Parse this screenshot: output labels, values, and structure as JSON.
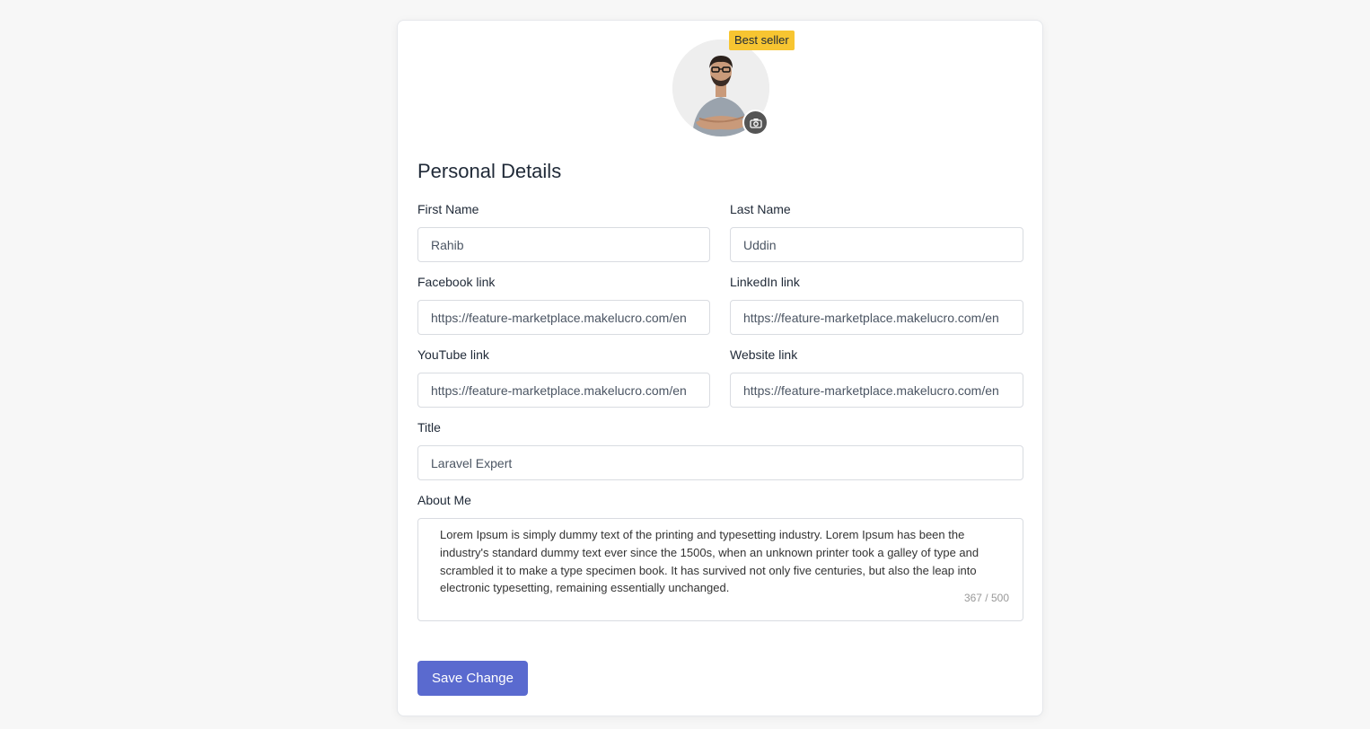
{
  "profile": {
    "badge": "Best seller",
    "avatar_icon": "camera-icon"
  },
  "section_title": "Personal Details",
  "fields": {
    "first_name": {
      "label": "First Name",
      "value": "Rahib"
    },
    "last_name": {
      "label": "Last Name",
      "value": "Uddin"
    },
    "facebook": {
      "label": "Facebook link",
      "value": "https://feature-marketplace.makelucro.com/en"
    },
    "linkedin": {
      "label": "LinkedIn link",
      "value": "https://feature-marketplace.makelucro.com/en"
    },
    "youtube": {
      "label": "YouTube link",
      "value": "https://feature-marketplace.makelucro.com/en"
    },
    "website": {
      "label": "Website link",
      "value": "https://feature-marketplace.makelucro.com/en"
    },
    "title": {
      "label": "Title",
      "value": "Laravel Expert"
    },
    "about": {
      "label": "About Me",
      "value": "Lorem Ipsum is simply dummy text of the printing and typesetting industry. Lorem Ipsum has been the industry's standard dummy text ever since the 1500s, when an unknown printer took a galley of type and scrambled it to make a type specimen book. It has survived not only five centuries, but also the leap into electronic typesetting, remaining essentially unchanged.",
      "counter": "367 / 500"
    }
  },
  "save_label": "Save Change",
  "colors": {
    "accent": "#5a6acf",
    "badge": "#f7c531",
    "background": "#f7f7f7"
  }
}
